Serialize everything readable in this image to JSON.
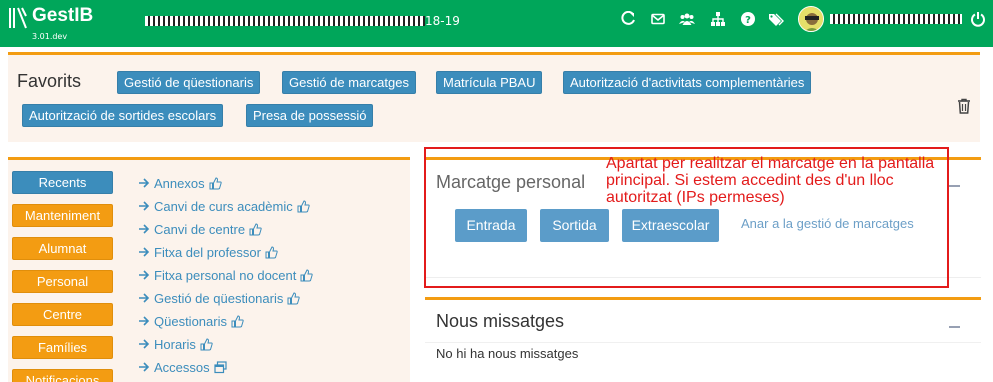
{
  "app": {
    "name": "GestIB",
    "version": "3.01.dev",
    "course_suffix": "18-19"
  },
  "topbar": {
    "icons": [
      "refresh-icon",
      "envelope-icon",
      "users-icon",
      "sitemap-icon",
      "question-icon",
      "tags-icon",
      "power-icon"
    ]
  },
  "favorits": {
    "title": "Favorits",
    "buttons": [
      "Gestió de qüestionaris",
      "Gestió de marcatges",
      "Matrícula PBAU",
      "Autorització d'activitats complementàries",
      "Autorització de sortides escolars",
      "Presa de possessió"
    ]
  },
  "menu": {
    "buttons": [
      "Recents",
      "Manteniment",
      "Alumnat",
      "Personal",
      "Centre",
      "Famílies",
      "Notificacions"
    ],
    "links": [
      "Annexos",
      "Canvi de curs acadèmic",
      "Canvi de centre",
      "Fitxa del professor",
      "Fitxa personal no docent",
      "Gestió de qüestionaris",
      "Qüestionaris",
      "Horaris",
      "Accessos"
    ]
  },
  "marcatge": {
    "title": "Marcatge personal",
    "buttons": [
      "Entrada",
      "Sortida",
      "Extraescolar"
    ],
    "link": "Anar a la gestió de marcatges",
    "annotation": "Apartat per realitzar el marcatge en la pantalla principal. Si estem accedint des d'un lloc autoritzat (IPs permeses)"
  },
  "messages": {
    "title": "Nous missatges",
    "body": "No hi ha nous missatges"
  },
  "colors": {
    "topbar": "#00a65a",
    "primary": "#3c8dbc",
    "warning": "#f39c12",
    "annotation": "#e31b1b"
  }
}
